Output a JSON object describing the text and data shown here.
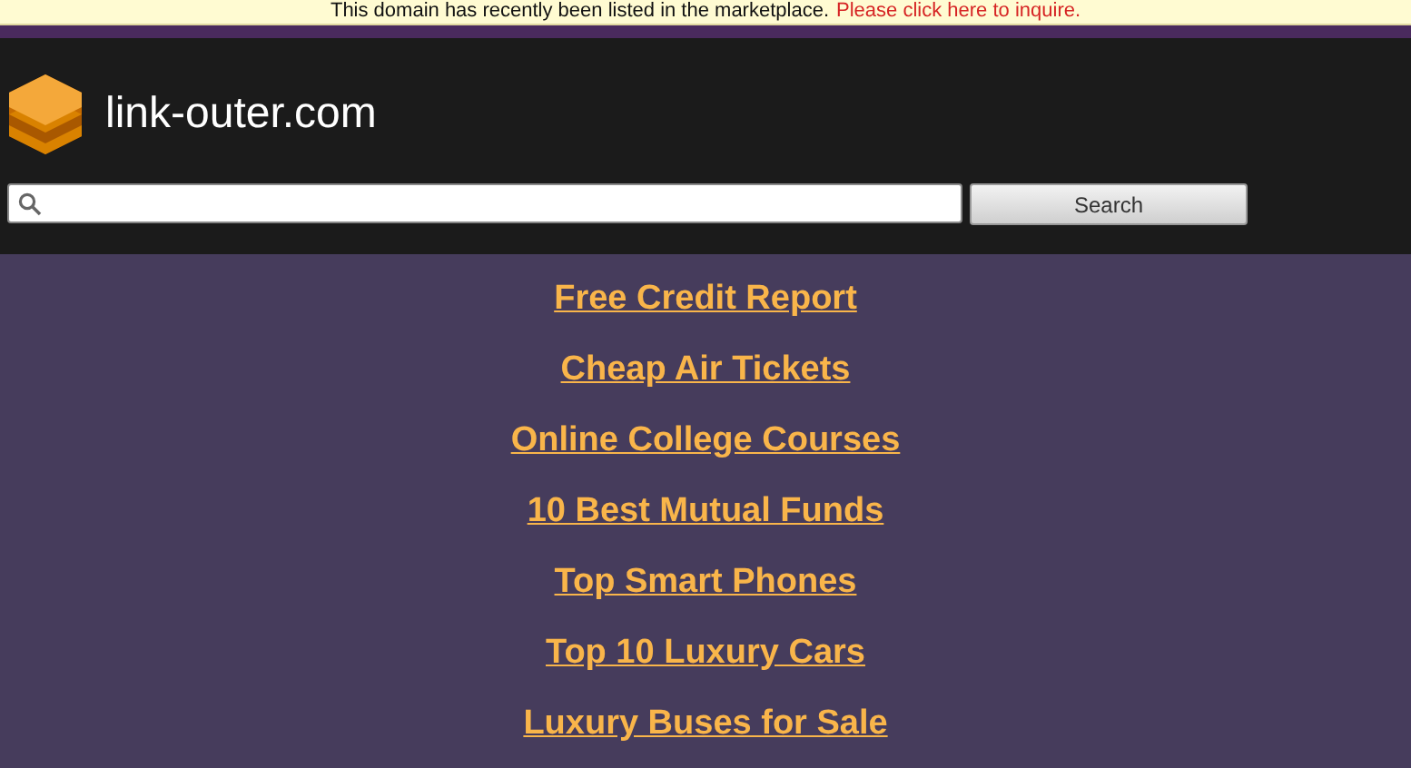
{
  "notice": {
    "text": "This domain has recently been listed in the marketplace.",
    "link": "Please click here to inquire."
  },
  "header": {
    "site_name": "link-outer.com"
  },
  "search": {
    "button": "Search"
  },
  "links": [
    "Free Credit Report",
    "Cheap Air Tickets",
    "Online College Courses",
    "10 Best Mutual Funds",
    "Top Smart Phones",
    "Top 10 Luxury Cars",
    "Luxury Buses for Sale"
  ]
}
